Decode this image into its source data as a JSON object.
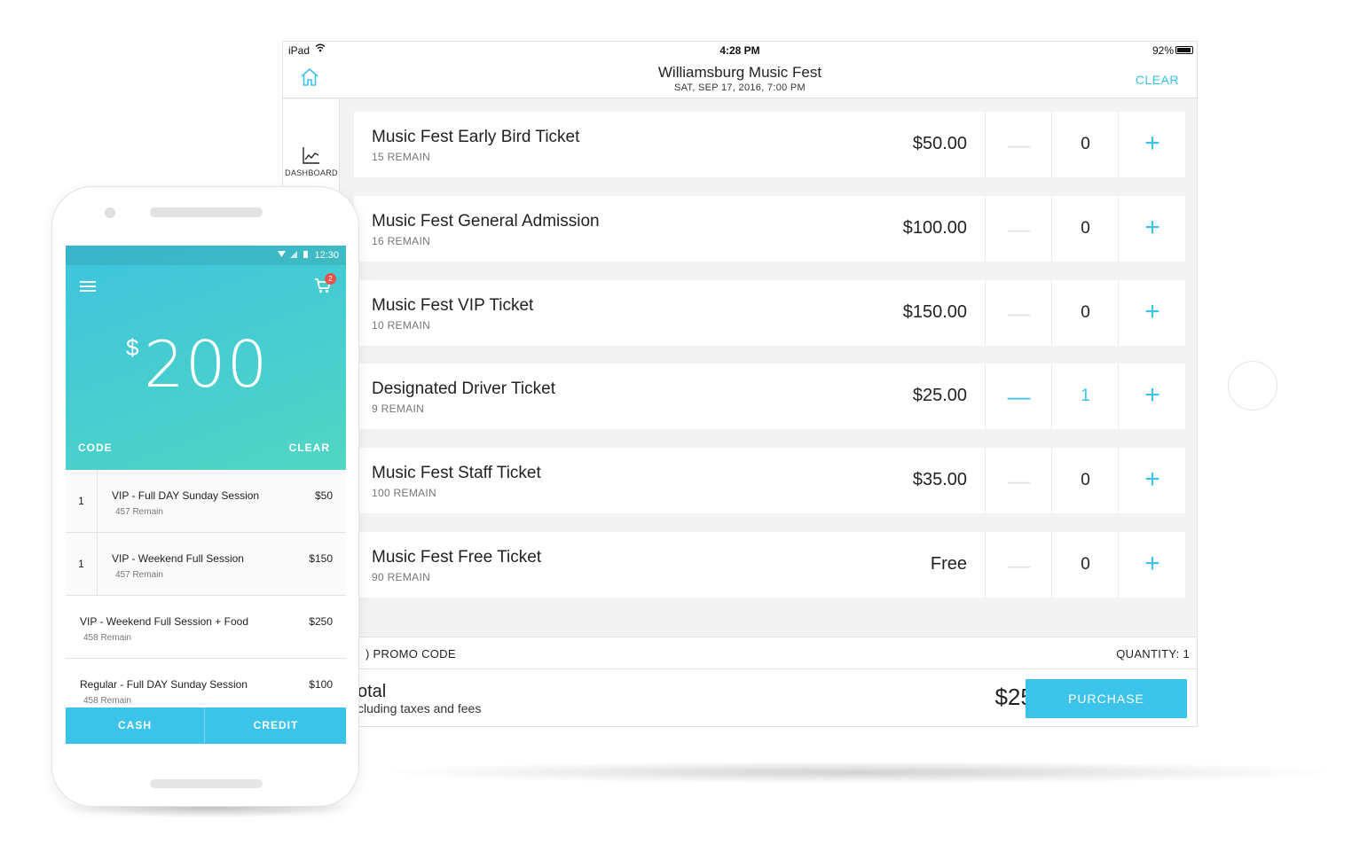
{
  "tablet": {
    "status": {
      "device": "iPad",
      "time": "4:28 PM",
      "battery": "92%"
    },
    "header": {
      "title": "Williamsburg Music Fest",
      "date": "SAT, SEP 17, 2016, 7:00 PM",
      "clear_label": "CLEAR"
    },
    "sidebar": {
      "dashboard_label": "DASHBOARD"
    },
    "tickets": [
      {
        "name": "Music Fest Early Bird Ticket",
        "remain": "15 REMAIN",
        "price": "$50.00",
        "qty": "0"
      },
      {
        "name": "Music Fest General Admission",
        "remain": "16 REMAIN",
        "price": "$100.00",
        "qty": "0"
      },
      {
        "name": "Music Fest VIP Ticket",
        "remain": "10 REMAIN",
        "price": "$150.00",
        "qty": "0"
      },
      {
        "name": "Designated Driver Ticket",
        "remain": "9 REMAIN",
        "price": "$25.00",
        "qty": "1"
      },
      {
        "name": "Music Fest Staff Ticket",
        "remain": "100 REMAIN",
        "price": "$35.00",
        "qty": "0"
      },
      {
        "name": "Music Fest Free Ticket",
        "remain": "90 REMAIN",
        "price": "Free",
        "qty": "0"
      }
    ],
    "minus_symbol": "—",
    "plus_symbol": "+",
    "promo_label": ") PROMO CODE",
    "quantity_label": "QUANTITY: 1",
    "total_label": "otal",
    "total_sub": "cluding taxes and fees",
    "total_amount": "$25.00",
    "purchase_label": "PURCHASE",
    "accent_color": "#3cc3ea"
  },
  "phone": {
    "status_time": "12:30",
    "cart_count": "2",
    "currency": "$",
    "amount": "200",
    "code_label": "CODE",
    "clear_label": "CLEAR",
    "items": [
      {
        "qty": "1",
        "name": "VIP - Full DAY Sunday Session",
        "remain": "457 Remain",
        "price": "$50"
      },
      {
        "qty": "1",
        "name": "VIP - Weekend Full Session",
        "remain": "457 Remain",
        "price": "$150"
      },
      {
        "qty": "",
        "name": "VIP - Weekend Full Session + Food",
        "remain": "458 Remain",
        "price": "$250"
      },
      {
        "qty": "",
        "name": "Regular - Full DAY Sunday Session",
        "remain": "458 Remain",
        "price": "$100"
      }
    ],
    "cash_label": "CASH",
    "credit_label": "CREDIT",
    "hero_gradient": [
      "#3ec4de",
      "#52d6c3"
    ]
  }
}
